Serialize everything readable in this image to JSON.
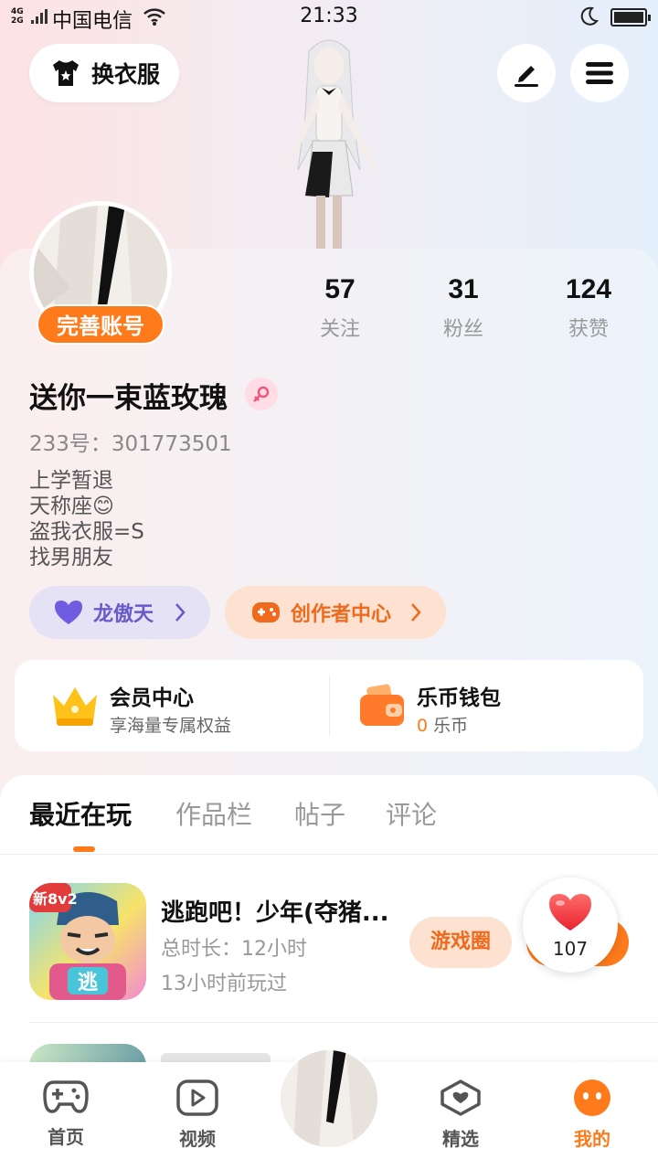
{
  "status_bar": {
    "network": "4G\n2G",
    "carrier": "中国电信",
    "time": "21:33"
  },
  "header": {
    "outfit_label": "换衣服",
    "edit_icon": "pen-icon",
    "menu_icon": "menu-icon"
  },
  "profile": {
    "complete_badge": "完善账号",
    "stats": [
      {
        "value": "57",
        "label": "关注"
      },
      {
        "value": "31",
        "label": "粉丝"
      },
      {
        "value": "124",
        "label": "获赞"
      }
    ],
    "username": "送你一束蓝玫瑰",
    "uid": "233号：301773501",
    "bio": [
      "上学暂退",
      "天称座😊",
      "盗我衣服=S",
      "找男朋友"
    ],
    "pills": {
      "dragon": "龙傲天",
      "creator": "创作者中心"
    }
  },
  "member_card": {
    "member_title": "会员中心",
    "member_sub": "享海量专属权益",
    "wallet_title": "乐币钱包",
    "wallet_amount": "0",
    "wallet_unit": "乐币"
  },
  "tabs": [
    "最近在玩",
    "作品栏",
    "帖子",
    "评论"
  ],
  "games": [
    {
      "title": "逃跑吧！少年(夺猪...",
      "duration": "总时长：12小时",
      "last_played": "13小时前玩过",
      "circle_button": "游戏圈",
      "icon_badge": "新8v2",
      "like_count": "107"
    }
  ],
  "bottom_nav": [
    {
      "label": "首页",
      "icon": "gamepad-icon"
    },
    {
      "label": "视频",
      "icon": "video-icon"
    },
    {
      "label": "精选",
      "icon": "heart-box-icon"
    },
    {
      "label": "我的",
      "icon": "me-icon"
    }
  ],
  "colors": {
    "accent": "#ff7a1a",
    "purple": "#6a59c9",
    "pink_bg": "#fde3e3",
    "blue_bg": "#e3effb"
  }
}
